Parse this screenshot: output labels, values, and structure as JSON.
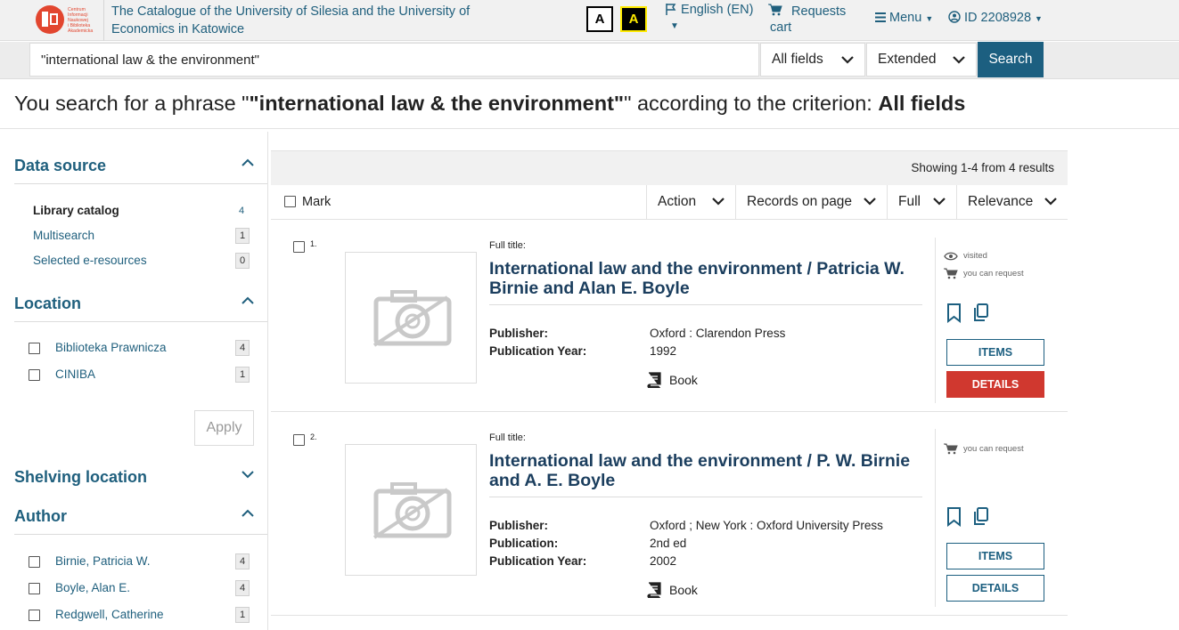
{
  "header": {
    "logo_text": [
      "Centrum",
      "Informacji",
      "Naukowej",
      "i Biblioteka",
      "Akademicka"
    ],
    "site_title": "The Catalogue of the University of Silesia and the University of Economics in Katowice",
    "contrast_normal": "A",
    "contrast_high": "A",
    "language": "English (EN)",
    "cart_line1": "Requests",
    "cart_line2": "cart",
    "menu": "Menu",
    "account": "ID 2208928"
  },
  "search": {
    "query": "\"international law & the environment\"",
    "criterion": "All fields",
    "mode": "Extended",
    "button": "Search"
  },
  "heading": {
    "prefix": "You search for a phrase \"",
    "phrase": "\"international law & the environment\"",
    "middle": "\" according to the criterion: ",
    "criterion": "All fields"
  },
  "sidebar": {
    "data_source": {
      "title": "Data source",
      "items": [
        {
          "label": "Library catalog",
          "count": "4"
        },
        {
          "label": "Multisearch",
          "count": "1"
        },
        {
          "label": "Selected e-resources",
          "count": "0"
        }
      ]
    },
    "location": {
      "title": "Location",
      "items": [
        {
          "label": "Biblioteka Prawnicza",
          "count": "4"
        },
        {
          "label": "CINIBA",
          "count": "1"
        }
      ],
      "apply": "Apply"
    },
    "shelving": {
      "title": "Shelving location"
    },
    "author": {
      "title": "Author",
      "items": [
        {
          "label": "Birnie, Patricia W.",
          "count": "4"
        },
        {
          "label": "Boyle, Alan E.",
          "count": "4"
        },
        {
          "label": "Redgwell, Catherine",
          "count": "1"
        }
      ]
    }
  },
  "results": {
    "showing": "Showing 1-4 from 4 results",
    "mark": "Mark",
    "toolbar": {
      "action": "Action",
      "records": "Records on page",
      "view": "Full",
      "sort": "Relevance"
    },
    "full_title_label": "Full title:",
    "items_label": "ITEMS",
    "details_label": "DETAILS",
    "list": [
      {
        "num": "1.",
        "title": "International law and the environment / Patricia W. Birnie and Alan E. Boyle",
        "meta": [
          {
            "label": "Publisher:",
            "value": "Oxford : Clarendon Press"
          },
          {
            "label": "Publication Year:",
            "value": "1992"
          }
        ],
        "format": "Book",
        "visited": "visited",
        "request": "you can request"
      },
      {
        "num": "2.",
        "title": "International law and the environment / P. W. Birnie and A. E. Boyle",
        "meta": [
          {
            "label": "Publisher:",
            "value": "Oxford ; New York : Oxford University Press"
          },
          {
            "label": "Publication:",
            "value": "2nd ed"
          },
          {
            "label": "Publication Year:",
            "value": "2002"
          }
        ],
        "format": "Book",
        "request": "you can request"
      }
    ]
  },
  "colors": {
    "brand": "#1c5f80",
    "link": "#1f5f7d",
    "details_active": "#d0382f",
    "logo": "#e2462f"
  }
}
